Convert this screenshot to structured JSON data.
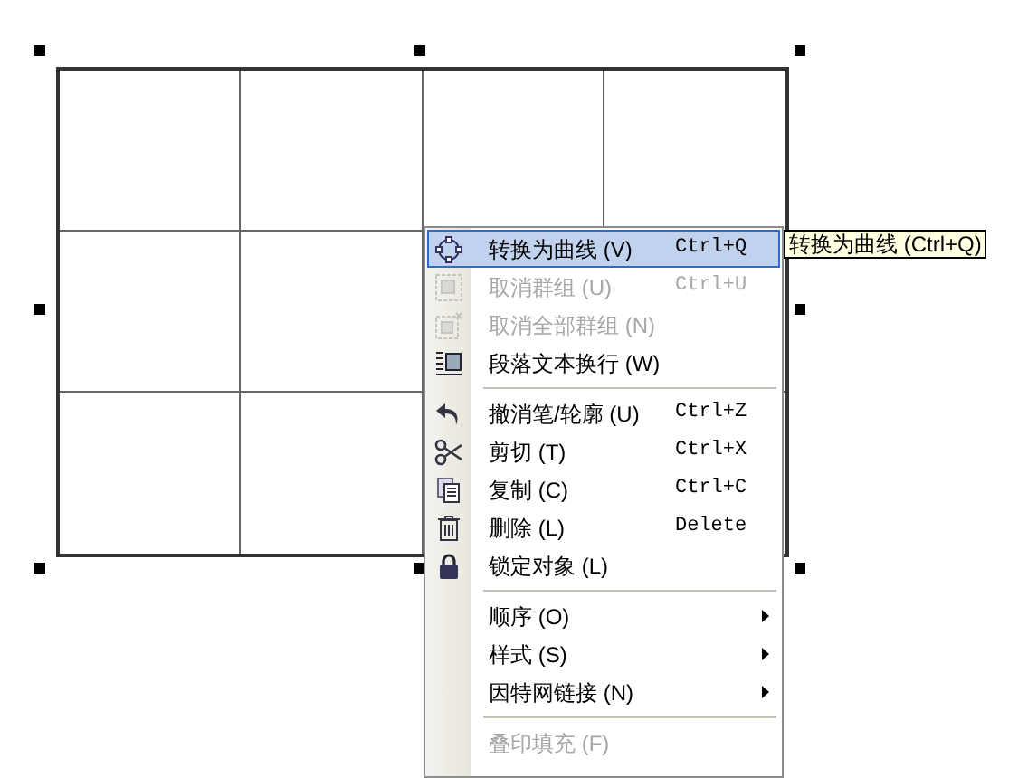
{
  "context_menu": {
    "items": [
      {
        "kind": "item",
        "label": "转换为曲线 (V)",
        "shortcut": "Ctrl+Q",
        "selected": true,
        "disabled": false
      },
      {
        "kind": "item",
        "label": "取消群组 (U)",
        "shortcut": "Ctrl+U",
        "selected": false,
        "disabled": true
      },
      {
        "kind": "item",
        "label": "取消全部群组 (N)",
        "selected": false,
        "disabled": true
      },
      {
        "kind": "item",
        "label": "段落文本换行 (W)",
        "selected": false,
        "disabled": false
      },
      {
        "kind": "separator"
      },
      {
        "kind": "item",
        "label": "撤消笔/轮廓 (U)",
        "shortcut": "Ctrl+Z",
        "selected": false,
        "disabled": false
      },
      {
        "kind": "item",
        "label": "剪切 (T)",
        "shortcut": "Ctrl+X",
        "selected": false,
        "disabled": false
      },
      {
        "kind": "item",
        "label": "复制 (C)",
        "shortcut": "Ctrl+C",
        "selected": false,
        "disabled": false
      },
      {
        "kind": "item",
        "label": "删除 (L)",
        "shortcut": "Delete",
        "selected": false,
        "disabled": false
      },
      {
        "kind": "item",
        "label": "锁定对象 (L)",
        "selected": false,
        "disabled": false
      },
      {
        "kind": "separator"
      },
      {
        "kind": "submenu",
        "label": "顺序 (O)",
        "selected": false,
        "disabled": false
      },
      {
        "kind": "submenu",
        "label": "样式 (S)",
        "selected": false,
        "disabled": false
      },
      {
        "kind": "submenu",
        "label": "因特网链接 (N)",
        "selected": false,
        "disabled": false
      },
      {
        "kind": "separator"
      },
      {
        "kind": "item",
        "label": "叠印填充 (F)",
        "selected": false,
        "disabled": true
      }
    ]
  },
  "tooltip": "转换为曲线 (Ctrl+Q)"
}
